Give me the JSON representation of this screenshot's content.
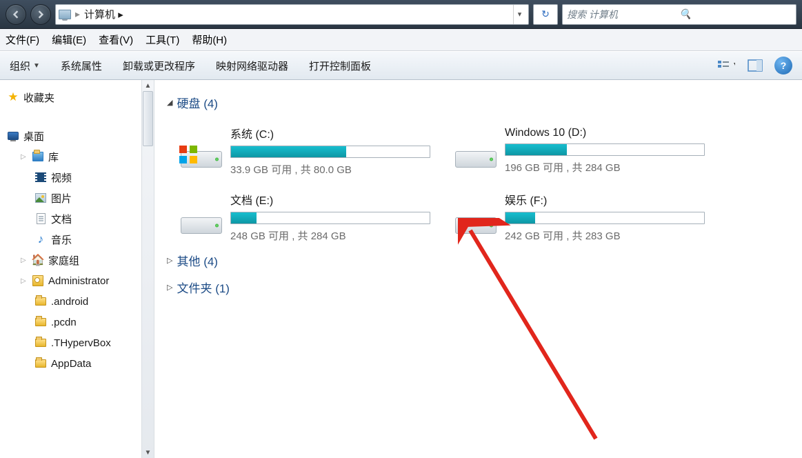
{
  "nav": {
    "breadcrumb": "计算机 ▸",
    "address_dropdown_glyph": "▾",
    "refresh_glyph": "↻",
    "search_placeholder": "搜索 计算机",
    "search_icon": "🔍"
  },
  "menu": {
    "file": "文件(F)",
    "edit": "编辑(E)",
    "view": "查看(V)",
    "tools": "工具(T)",
    "help": "帮助(H)"
  },
  "toolbar": {
    "organize": "组织",
    "system_props": "系统属性",
    "uninstall": "卸载或更改程序",
    "map_drive": "映射网络驱动器",
    "control_panel": "打开控制面板",
    "dd_glyph": "▼",
    "help_glyph": "?"
  },
  "sidebar": {
    "favorites": "收藏夹",
    "desktop": "桌面",
    "libraries": "库",
    "videos": "视频",
    "pictures": "图片",
    "documents": "文档",
    "music": "音乐",
    "homegroup": "家庭组",
    "admin": "Administrator",
    "android": ".android",
    "pcdn": ".pcdn",
    "thyperv": ".THypervBox",
    "appdata": "AppData"
  },
  "groups": {
    "hdd": {
      "label": "硬盘 (4)",
      "open": true
    },
    "other": {
      "label": "其他 (4)",
      "open": false
    },
    "folders": {
      "label": "文件夹 (1)",
      "open": false
    }
  },
  "drives": [
    {
      "name": "系统 (C:)",
      "free": "33.9 GB 可用 , 共 80.0 GB",
      "fill_pct": 58,
      "system": true
    },
    {
      "name": "Windows 10 (D:)",
      "free": "196 GB 可用 , 共 284 GB",
      "fill_pct": 31,
      "system": false
    },
    {
      "name": "文档 (E:)",
      "free": "248 GB 可用 , 共 284 GB",
      "fill_pct": 13,
      "system": false
    },
    {
      "name": "娱乐 (F:)",
      "free": "242 GB 可用 , 共 283 GB",
      "fill_pct": 15,
      "system": false
    }
  ],
  "tri": {
    "open": "◢",
    "closed": "▷"
  }
}
